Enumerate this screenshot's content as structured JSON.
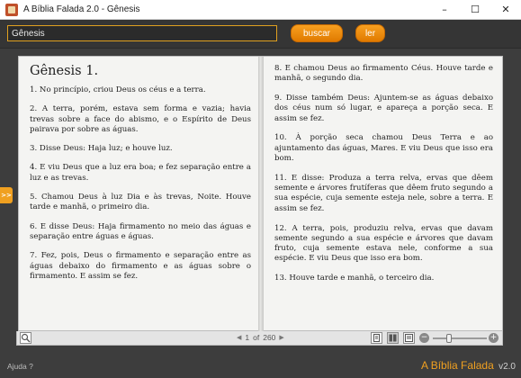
{
  "window": {
    "title": "A Bíblia Falada 2.0 - Gênesis",
    "minimize": "–",
    "maximize": "☐",
    "close": "✕"
  },
  "search": {
    "value": "Gênesis",
    "search_label": "buscar",
    "read_label": "ler"
  },
  "side_tab": {
    "label": ">>"
  },
  "book": {
    "title": "Gênesis 1.",
    "left_verses": [
      "1. No princípio, criou Deus os céus e a terra.",
      "2. A terra, porém, estava sem forma e vazia; havia trevas sobre a face do abismo, e o Espírito de Deus pairava por sobre as águas.",
      "3. Disse Deus: Haja luz; e houve luz.",
      "4. E viu Deus que a luz era boa; e fez separação entre a luz e as trevas.",
      "5. Chamou Deus à luz Dia e às trevas, Noite. Houve tarde e manhã, o primeiro dia.",
      "6. E disse Deus: Haja firmamento no meio das águas e separação entre águas e águas.",
      "7. Fez, pois, Deus o firmamento e separação entre as águas debaixo do firmamento e as águas sobre o firmamento. E assim se fez."
    ],
    "right_verses": [
      "8. E chamou Deus ao firmamento Céus. Houve tarde e manhã, o segundo dia.",
      "9. Disse também Deus: Ajuntem-se as águas debaixo dos céus num só lugar, e apareça a porção seca. E assim se fez.",
      "10. À porção seca chamou Deus Terra e ao ajuntamento das águas, Mares. E viu Deus que isso era bom.",
      "11. E disse: Produza a terra relva, ervas que dêem semente e árvores frutíferas que dêem fruto segundo a sua espécie, cuja semente esteja nele, sobre a terra. E assim se fez.",
      "12. A terra, pois, produziu relva, ervas que davam semente segundo a sua espécie e árvores que davam fruto, cuja semente estava nele, conforme a sua espécie. E viu Deus que isso era bom.",
      "13. Houve tarde e manhã, o terceiro dia."
    ]
  },
  "pager": {
    "current": "1",
    "of_label": "of",
    "total": "260"
  },
  "zoom": {
    "minus": "−",
    "plus": "+",
    "level": 0.3
  },
  "footer": {
    "help": "Ajuda ?",
    "brand_name": "A Bíblia Falada",
    "brand_version": "v2.0"
  },
  "colors": {
    "accent": "#f0a020",
    "background": "#3d3d3d",
    "page": "#f4f4f2"
  }
}
